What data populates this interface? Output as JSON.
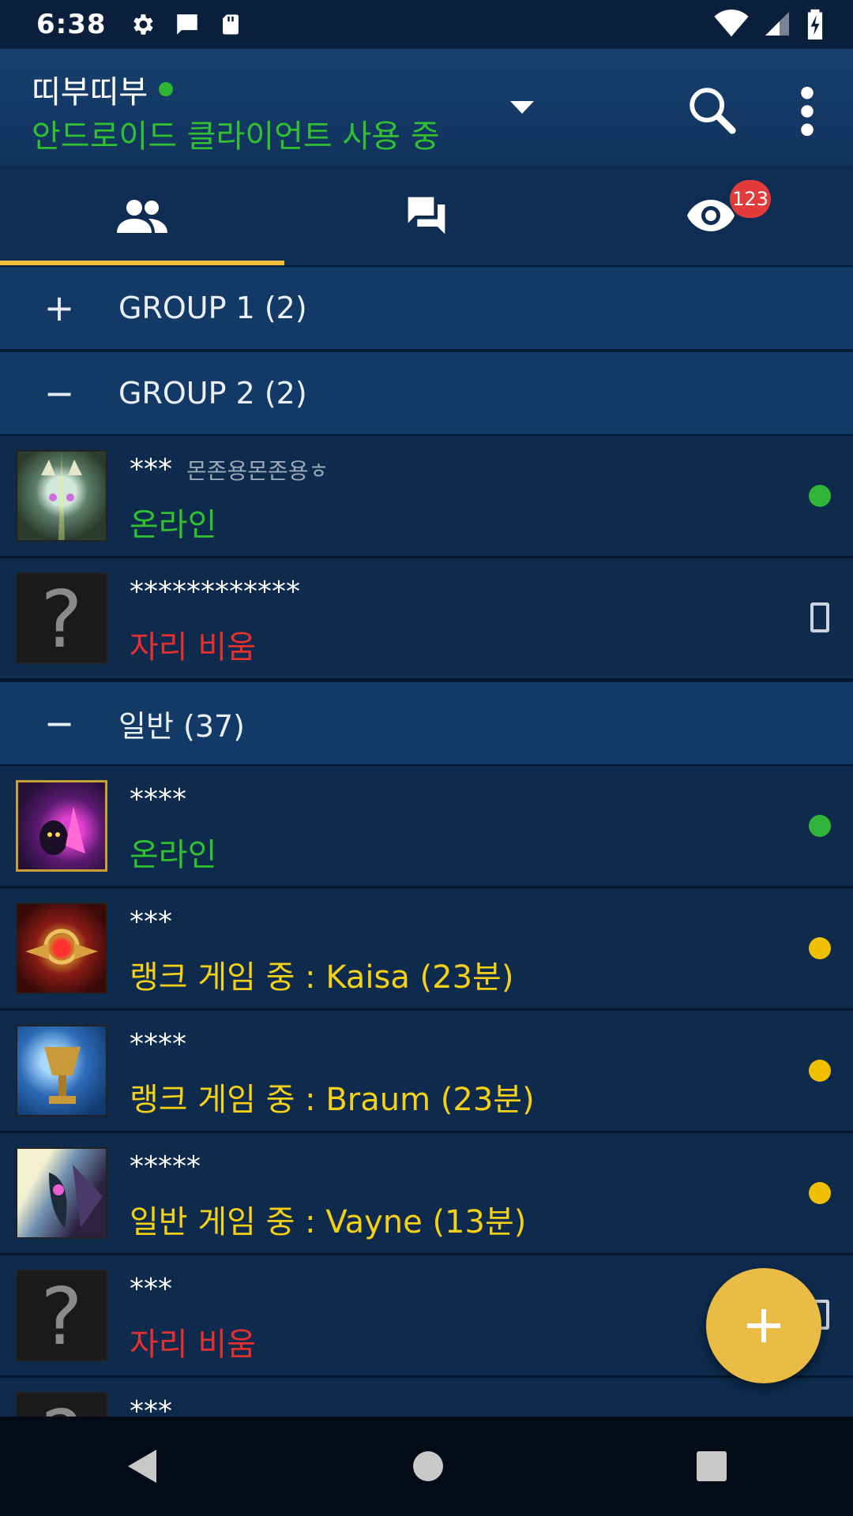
{
  "status_bar": {
    "time": "6:38",
    "icons": [
      "settings-icon",
      "message-icon",
      "sd-card-icon"
    ],
    "right_icons": [
      "wifi-icon",
      "signal-icon",
      "battery-charging-icon"
    ]
  },
  "app_bar": {
    "account_name": "띠부띠부",
    "account_status": "안드로이드 클라이언트 사용 중",
    "status_color": "#30c030"
  },
  "tabs": [
    {
      "name": "friends",
      "icon": "people-icon",
      "active": true
    },
    {
      "name": "chats",
      "icon": "chat-icon",
      "badge": "123"
    },
    {
      "name": "watch",
      "icon": "eye-icon"
    }
  ],
  "groups": [
    {
      "toggle": "+",
      "label": "GROUP 1 (2)"
    },
    {
      "toggle": "−",
      "label": "GROUP 2 (2)"
    },
    {
      "toggle": "−",
      "label": "일반 (37)"
    }
  ],
  "friends": [
    {
      "name": "***",
      "note": "몬존용몬존용ㅎ",
      "status": "온라인",
      "status_type": "online",
      "indicator": "green-dot",
      "avatar": "cat-warrior"
    },
    {
      "name": "************",
      "note": "",
      "status": "자리 비움",
      "status_type": "away",
      "indicator": "phone",
      "avatar": "unknown"
    },
    {
      "name": "****",
      "note": "",
      "status": "온라인",
      "status_type": "online",
      "indicator": "green-dot",
      "avatar": "purple-mage"
    },
    {
      "name": "***",
      "note": "",
      "status": "랭크 게임 중 : Kaisa (23분)",
      "status_type": "ingame",
      "indicator": "yellow-dot",
      "avatar": "red-emblem"
    },
    {
      "name": "****",
      "note": "",
      "status": "랭크 게임 중 : Braum (23분)",
      "status_type": "ingame",
      "indicator": "yellow-dot",
      "avatar": "golden-chalice"
    },
    {
      "name": "*****",
      "note": "",
      "status": "일반 게임 중 : Vayne (13분)",
      "status_type": "ingame",
      "indicator": "yellow-dot",
      "avatar": "dark-bird"
    },
    {
      "name": "***",
      "note": "",
      "status": "자리 비움",
      "status_type": "away",
      "indicator": "phone",
      "avatar": "unknown"
    },
    {
      "name": "***",
      "note": "",
      "status": "",
      "status_type": "away",
      "indicator": "",
      "avatar": "unknown"
    }
  ],
  "fab": {
    "icon": "plus-icon"
  },
  "nav": [
    "back-icon",
    "home-icon",
    "recents-icon"
  ]
}
